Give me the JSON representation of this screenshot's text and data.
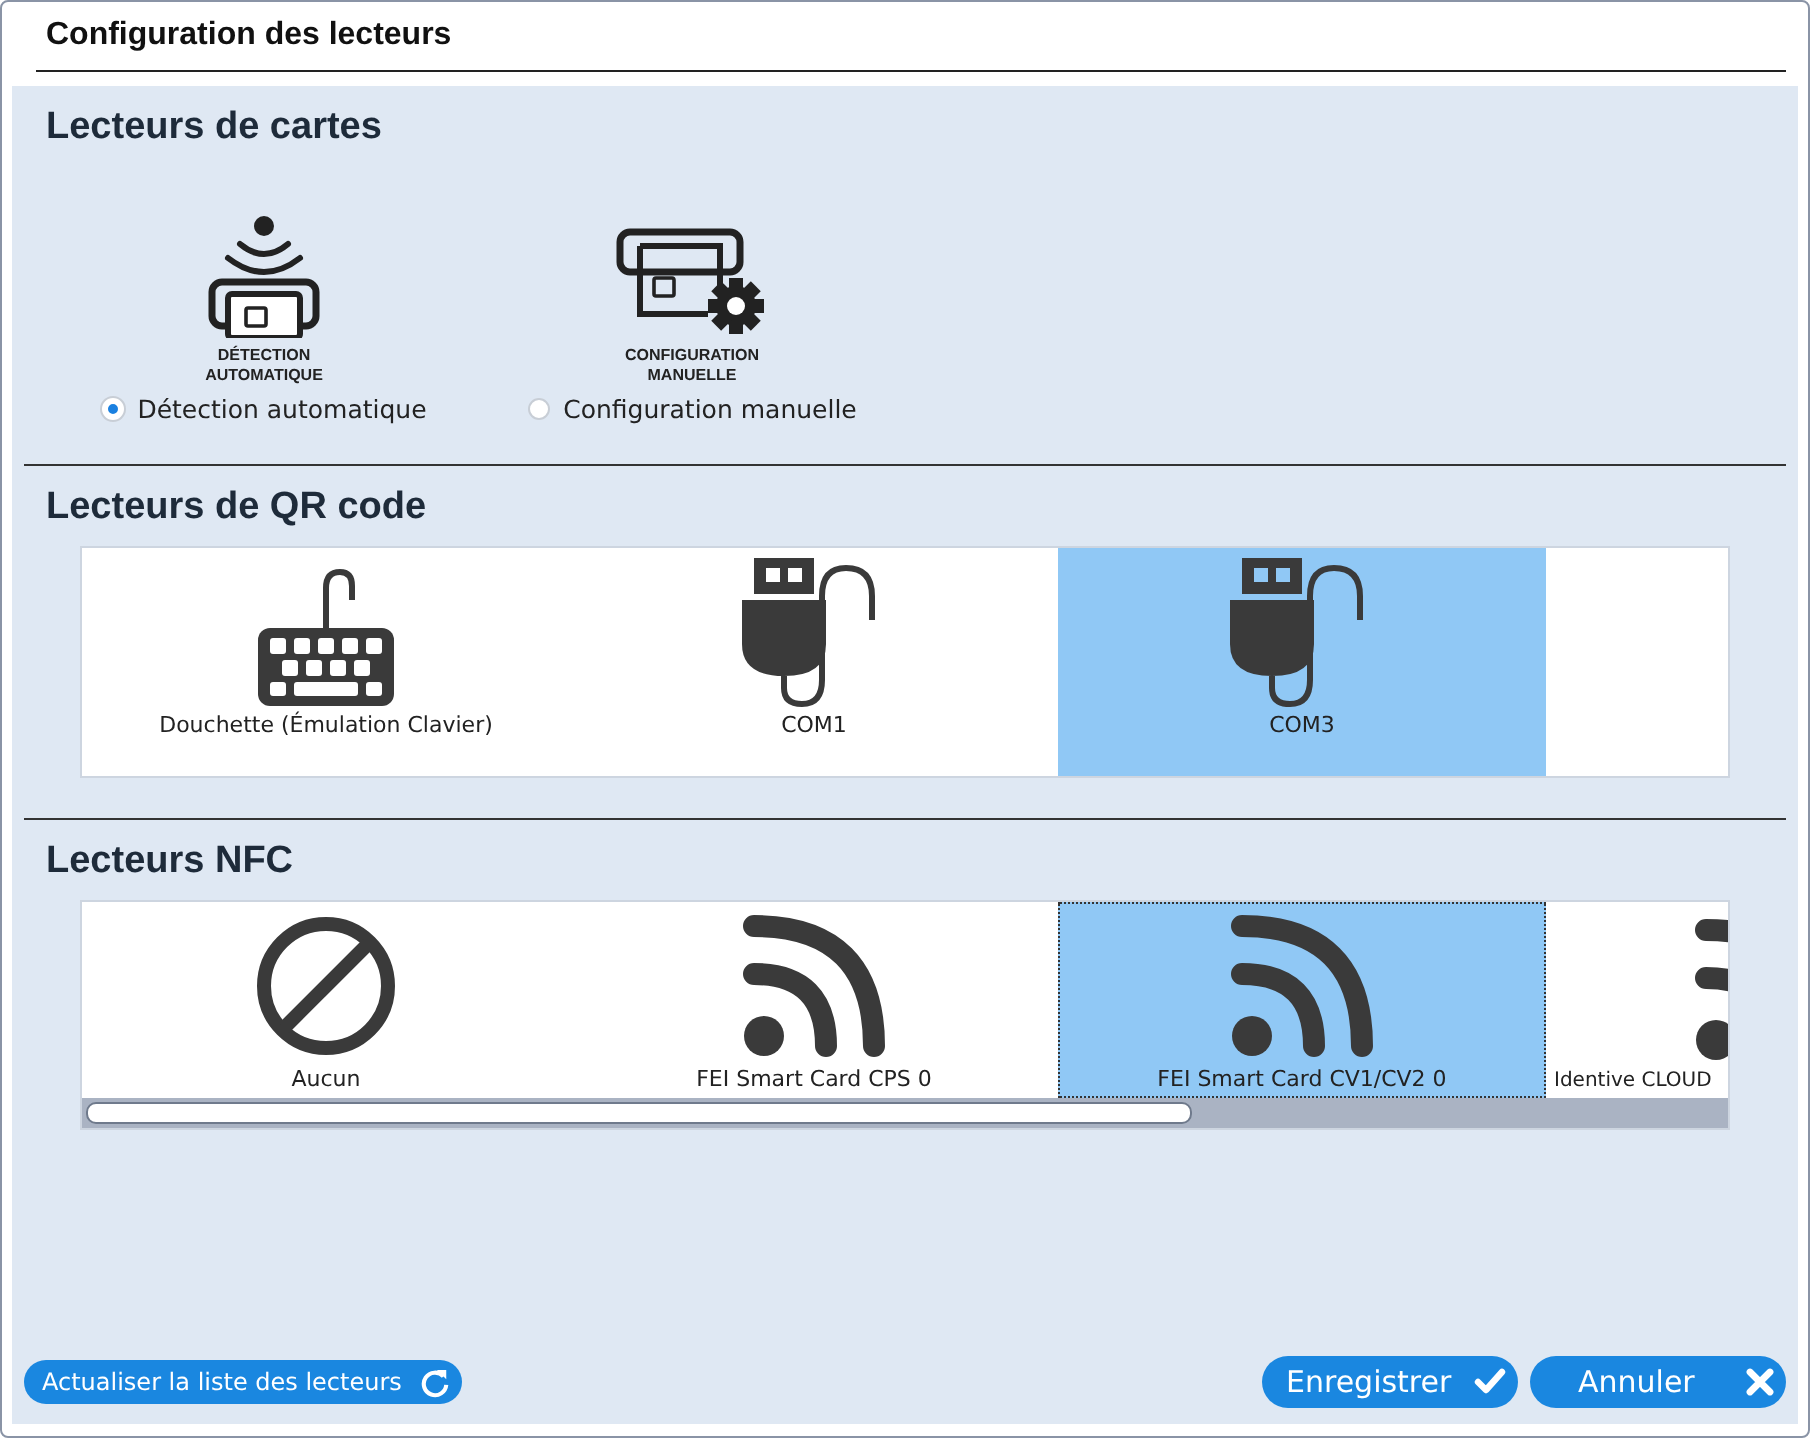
{
  "window": {
    "title": "Configuration des lecteurs"
  },
  "card_readers": {
    "heading": "Lecteurs de cartes",
    "options": [
      {
        "kind": "auto",
        "caption_lines": [
          "DÉTECTION",
          "AUTOMATIQUE"
        ],
        "label": "Détection automatique",
        "selected": true
      },
      {
        "kind": "manual",
        "caption_lines": [
          "CONFIGURATION",
          "MANUELLE"
        ],
        "label": "Configuration manuelle",
        "selected": false
      }
    ]
  },
  "qr_readers": {
    "heading": "Lecteurs de QR code",
    "items": [
      {
        "kind": "keyboard",
        "label": "Douchette (Émulation Clavier)",
        "selected": false
      },
      {
        "kind": "usb",
        "label": "COM1",
        "selected": false
      },
      {
        "kind": "usb",
        "label": "COM3",
        "selected": true
      }
    ]
  },
  "nfc_readers": {
    "heading": "Lecteurs NFC",
    "items": [
      {
        "kind": "none",
        "label": "Aucun",
        "selected": false
      },
      {
        "kind": "wireless",
        "label": "FEI Smart Card CPS 0",
        "selected": false
      },
      {
        "kind": "wireless",
        "label": "FEI Smart Card CV1/CV2 0",
        "selected": true
      },
      {
        "kind": "wireless",
        "label": "Identive CLOUD",
        "selected": false
      }
    ]
  },
  "buttons": [
    {
      "kind": "refresh",
      "label": "Actualiser la liste des lecteurs"
    },
    {
      "kind": "save",
      "label": "Enregistrer"
    },
    {
      "kind": "cancel",
      "label": "Annuler"
    }
  ]
}
